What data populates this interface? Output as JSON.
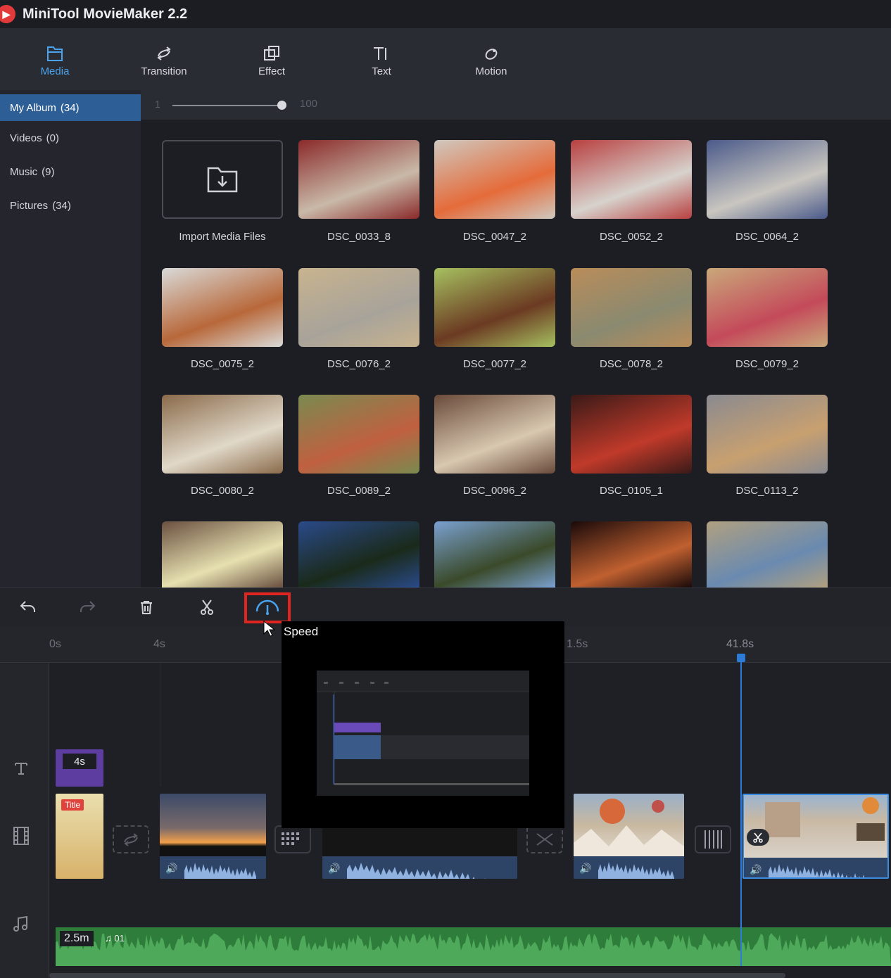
{
  "app": {
    "title": "MiniTool MovieMaker 2.2"
  },
  "toolbar": {
    "tabs": [
      {
        "label": "Media",
        "icon": "folder-icon",
        "active": true
      },
      {
        "label": "Transition",
        "icon": "transition-icon",
        "active": false
      },
      {
        "label": "Effect",
        "icon": "effect-icon",
        "active": false
      },
      {
        "label": "Text",
        "icon": "text-icon",
        "active": false
      },
      {
        "label": "Motion",
        "icon": "motion-icon",
        "active": false
      }
    ]
  },
  "sidebar": {
    "items": [
      {
        "label": "My Album",
        "count": "(34)",
        "active": true
      },
      {
        "label": "Videos",
        "count": "(0)",
        "active": false
      },
      {
        "label": "Music",
        "count": "(9)",
        "active": false
      },
      {
        "label": "Pictures",
        "count": "(34)",
        "active": false
      }
    ]
  },
  "zoom": {
    "min": "1",
    "max": "100"
  },
  "media": {
    "import_label": "Import Media Files",
    "files": [
      {
        "name": "DSC_0033_8",
        "colors": [
          "#8a2a2a",
          "#c9b9a8"
        ]
      },
      {
        "name": "DSC_0047_2",
        "colors": [
          "#cfc8be",
          "#e56b3a"
        ]
      },
      {
        "name": "DSC_0052_2",
        "colors": [
          "#b84040",
          "#d7d2cc"
        ]
      },
      {
        "name": "DSC_0064_2",
        "colors": [
          "#4a5a8a",
          "#c9c6c0"
        ]
      },
      {
        "name": "DSC_0075_2",
        "colors": [
          "#d9dad8",
          "#b8683a"
        ]
      },
      {
        "name": "DSC_0076_2",
        "colors": [
          "#c8b38e",
          "#a8a39a"
        ]
      },
      {
        "name": "DSC_0077_2",
        "colors": [
          "#a6c060",
          "#6b3a22"
        ]
      },
      {
        "name": "DSC_0078_2",
        "colors": [
          "#b98c5a",
          "#8a8a70"
        ]
      },
      {
        "name": "DSC_0079_2",
        "colors": [
          "#c9a87a",
          "#c44a5a"
        ]
      },
      {
        "name": "DSC_0080_2",
        "colors": [
          "#8a6a4a",
          "#e0d8c8"
        ]
      },
      {
        "name": "DSC_0089_2",
        "colors": [
          "#7a8a50",
          "#c06040"
        ]
      },
      {
        "name": "DSC_0096_2",
        "colors": [
          "#6a4a3a",
          "#d8c8b0"
        ]
      },
      {
        "name": "DSC_0105_1",
        "colors": [
          "#3a1a18",
          "#c03a2a"
        ]
      },
      {
        "name": "DSC_0113_2",
        "colors": [
          "#8a8a90",
          "#c8a070"
        ]
      },
      {
        "name": "",
        "colors": [
          "#6a5040",
          "#e6e0b0"
        ]
      },
      {
        "name": "",
        "colors": [
          "#2a4a8a",
          "#1a2a1a"
        ]
      },
      {
        "name": "",
        "colors": [
          "#7aa0d0",
          "#3a4a2a"
        ]
      },
      {
        "name": "",
        "colors": [
          "#1a0a0a",
          "#c06030"
        ]
      },
      {
        "name": "",
        "colors": [
          "#b0a080",
          "#6a8ab0"
        ]
      }
    ]
  },
  "timeline": {
    "ruler": {
      "t0": "0s",
      "t1": "4s",
      "t2": "1.5s",
      "t3": "41.8s"
    },
    "text_clip_duration": "4s",
    "title_badge": "Title",
    "music_duration": "2.5m",
    "music_name": "01",
    "tooltip": "Speed"
  },
  "colors": {
    "accent": "#4aa3ee",
    "selected": "#2d5e95",
    "highlight": "#e0241f",
    "playhead": "#2d7bd8",
    "music": "#2e7d3a"
  }
}
